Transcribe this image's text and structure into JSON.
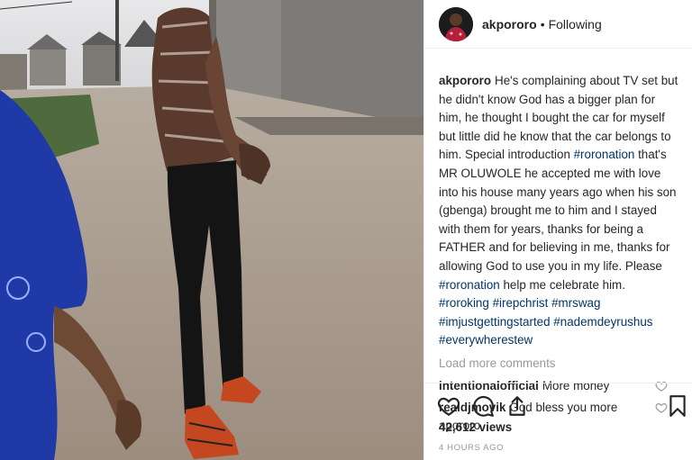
{
  "header": {
    "username": "akpororo",
    "separator": "•",
    "follow_status": "Following"
  },
  "caption": {
    "username": "akpororo",
    "segments": [
      {
        "text": "He's complaining about TV set but he didn't know God has a bigger plan for him, he thought I bought the car for myself but little did he know that the car belongs to him. Special introduction ",
        "tag": false
      },
      {
        "text": "#roronation",
        "tag": true
      },
      {
        "text": " that's MR OLUWOLE he accepted me with love into his house many years ago when his son (gbenga) brought me to him and I stayed with them for years, thanks for being a FATHER and for believing in me, thanks for allowing God to use you in my life. Please ",
        "tag": false
      },
      {
        "text": "#roronation",
        "tag": true
      },
      {
        "text": " help me celebrate him. ",
        "tag": false
      },
      {
        "text": "#roroking",
        "tag": true
      },
      {
        "text": " ",
        "tag": false
      },
      {
        "text": "#irepchrist",
        "tag": true
      },
      {
        "text": " ",
        "tag": false
      },
      {
        "text": "#mrswag",
        "tag": true
      },
      {
        "text": " ",
        "tag": false
      },
      {
        "text": "#imjustgettingstarted",
        "tag": true
      },
      {
        "text": " ",
        "tag": false
      },
      {
        "text": "#nademdeyrushus",
        "tag": true
      },
      {
        "text": " ",
        "tag": false
      },
      {
        "text": "#everywherestew",
        "tag": true
      }
    ]
  },
  "load_more_label": "Load more comments",
  "comments": [
    {
      "username": "intentionalofficial",
      "text": "More money"
    },
    {
      "username": "realdjmovik",
      "text": "God bless you more apororo"
    }
  ],
  "icons": {
    "like": "heart-icon",
    "comment": "comment-icon",
    "share": "share-icon",
    "save": "bookmark-icon"
  },
  "views": "42,612 views",
  "timestamp": "4 HOURS AGO",
  "colors": {
    "hashtag": "#003569",
    "muted": "#999999",
    "text": "#262626"
  }
}
